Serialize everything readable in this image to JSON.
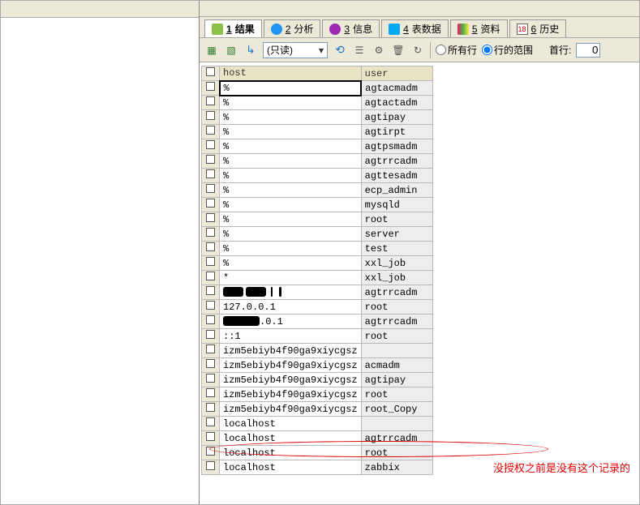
{
  "tabs": [
    {
      "num": "1",
      "label": "结果",
      "icon": "ico-results",
      "active": true
    },
    {
      "num": "2",
      "label": "分析",
      "icon": "ico-analyze"
    },
    {
      "num": "3",
      "label": "信息",
      "icon": "ico-info"
    },
    {
      "num": "4",
      "label": "表数据",
      "icon": "ico-form"
    },
    {
      "num": "5",
      "label": "资料",
      "icon": "ico-data"
    },
    {
      "num": "6",
      "label": "历史",
      "icon": "ico-history",
      "icon_text": "18"
    }
  ],
  "toolbar": {
    "mode_select": "(只读)",
    "radio_all": "所有行",
    "radio_range": "行的范围",
    "first_row_label": "首行:",
    "first_row_value": "0"
  },
  "grid": {
    "columns": {
      "host": "host",
      "user": "user"
    },
    "rows": [
      {
        "host": "%",
        "user": "agtacmadm"
      },
      {
        "host": "%",
        "user": "agtactadm"
      },
      {
        "host": "%",
        "user": "agtipay"
      },
      {
        "host": "%",
        "user": "agtirpt"
      },
      {
        "host": "%",
        "user": "agtpsmadm"
      },
      {
        "host": "%",
        "user": "agtrrcadm"
      },
      {
        "host": "%",
        "user": "agttesadm"
      },
      {
        "host": "%",
        "user": "ecp_admin"
      },
      {
        "host": "%",
        "user": "mysqld"
      },
      {
        "host": "%",
        "user": "root"
      },
      {
        "host": "%",
        "user": "server"
      },
      {
        "host": "%",
        "user": "test"
      },
      {
        "host": "%",
        "user": "xxl_job"
      },
      {
        "host": "*",
        "user": "xxl_job"
      },
      {
        "host": "",
        "user": "agtrrcadm",
        "redacted": true,
        "redact_pattern": [
          25,
          3,
          25,
          6,
          2,
          8,
          3,
          8
        ]
      },
      {
        "host": "127.0.0.1",
        "user": "root"
      },
      {
        "host": ".0.1",
        "user": "agtrrcadm",
        "redacted": true,
        "redact_pattern": [
          45
        ]
      },
      {
        "host": "::1",
        "user": "root"
      },
      {
        "host": "izm5ebiyb4f90ga9xiycgsz",
        "user": ""
      },
      {
        "host": "izm5ebiyb4f90ga9xiycgsz",
        "user": "acmadm"
      },
      {
        "host": "izm5ebiyb4f90ga9xiycgsz",
        "user": "agtipay",
        "highlight": true
      },
      {
        "host": "izm5ebiyb4f90ga9xiycgsz",
        "user": "root"
      },
      {
        "host": "izm5ebiyb4f90ga9xiycgsz",
        "user": "root_Copy"
      },
      {
        "host": "localhost",
        "user": ""
      },
      {
        "host": "localhost",
        "user": "agtrrcadm"
      },
      {
        "host": "localhost",
        "user": "root"
      },
      {
        "host": "localhost",
        "user": "zabbix"
      }
    ]
  },
  "annotation": {
    "text": "没授权之前是没有这个记录的"
  }
}
